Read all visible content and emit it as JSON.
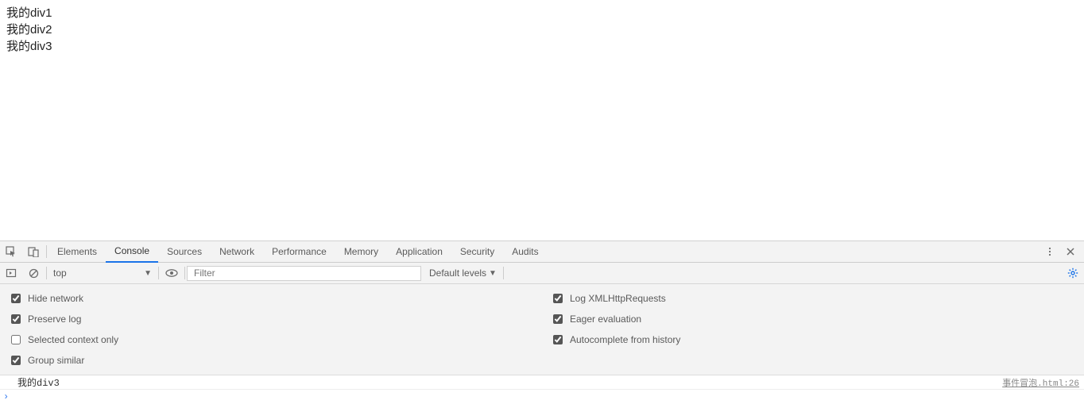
{
  "page": {
    "divs": [
      "我的div1",
      "我的div2",
      "我的div3"
    ]
  },
  "tabs": {
    "items": [
      "Elements",
      "Console",
      "Sources",
      "Network",
      "Performance",
      "Memory",
      "Application",
      "Security",
      "Audits"
    ],
    "active_index": 1
  },
  "console_toolbar": {
    "context": "top",
    "filter_placeholder": "Filter",
    "levels": "Default levels"
  },
  "settings": {
    "left": [
      {
        "label": "Hide network",
        "checked": true
      },
      {
        "label": "Preserve log",
        "checked": true
      },
      {
        "label": "Selected context only",
        "checked": false
      },
      {
        "label": "Group similar",
        "checked": true
      }
    ],
    "right": [
      {
        "label": "Log XMLHttpRequests",
        "checked": true
      },
      {
        "label": "Eager evaluation",
        "checked": true
      },
      {
        "label": "Autocomplete from history",
        "checked": true
      }
    ]
  },
  "console": {
    "line": {
      "message": "我的div3",
      "source": "事件冒泡.html:26"
    },
    "prompt": "›"
  }
}
